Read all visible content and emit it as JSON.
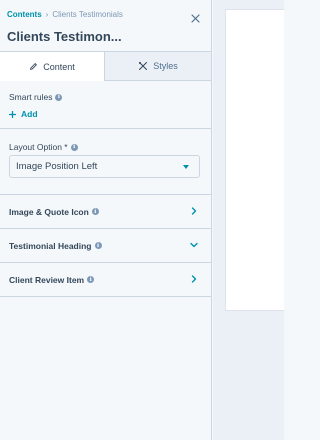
{
  "breadcrumb": {
    "root": "Contents",
    "separator": "›",
    "current": "Clients Testimonials"
  },
  "header": {
    "title": "Clients Testimon..."
  },
  "tabs": [
    {
      "label": "Content",
      "icon": "pencil-icon",
      "active": true
    },
    {
      "label": "Styles",
      "icon": "brush-icon",
      "active": false
    }
  ],
  "smart_rules": {
    "label": "Smart rules",
    "add_label": "Add"
  },
  "layout_option": {
    "label": "Layout Option *",
    "value": "Image Position Left"
  },
  "accordions": [
    {
      "label": "Image & Quote Icon",
      "state": "collapsed"
    },
    {
      "label": "Testimonial Heading",
      "state": "expanded"
    },
    {
      "label": "Client Review Item",
      "state": "collapsed"
    }
  ],
  "colors": {
    "accent": "#0091ae",
    "text": "#33475b",
    "border": "#cbd6e2",
    "panel": "#f5f8fa"
  }
}
